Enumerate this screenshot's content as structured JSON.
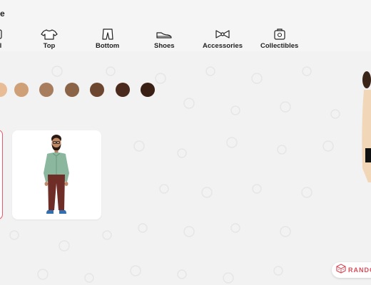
{
  "header": {
    "title_fragment": "e"
  },
  "tabs": [
    {
      "label": "l",
      "icon": "full-outfit-icon"
    },
    {
      "label": "Top",
      "icon": "shirt-icon"
    },
    {
      "label": "Bottom",
      "icon": "pants-icon"
    },
    {
      "label": "Shoes",
      "icon": "shoe-icon"
    },
    {
      "label": "Accessories",
      "icon": "bow-icon"
    },
    {
      "label": "Collectibles",
      "icon": "collectibles-icon"
    }
  ],
  "skin_tones": [
    "#e8bd96",
    "#cf9f78",
    "#a87d5d",
    "#8b6448",
    "#6d4630",
    "#4a2a1d",
    "#3a1f14"
  ],
  "avatar_cards": [
    {
      "selected": true
    },
    {
      "selected": false
    }
  ],
  "random_button": {
    "label": "RANDO",
    "icon": "dice-icon"
  },
  "colors": {
    "accent": "#e35d6a",
    "background": "#f2f2f2",
    "card": "#ffffff"
  }
}
